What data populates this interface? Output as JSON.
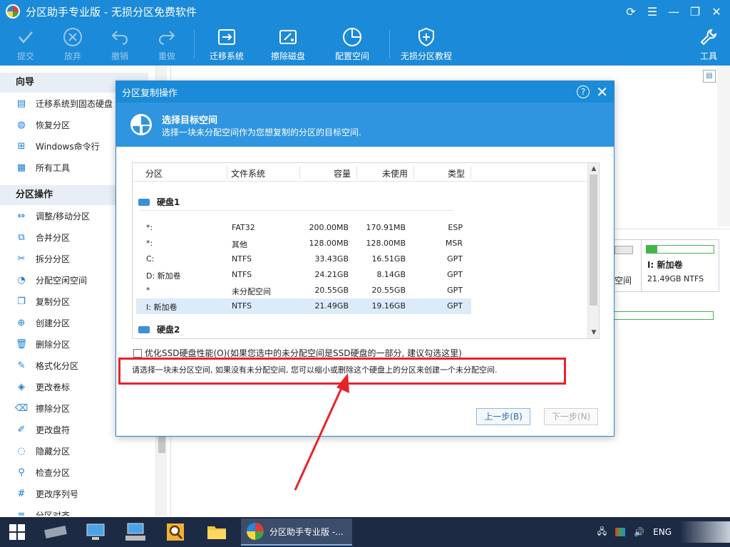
{
  "window": {
    "title": "分区助手专业版 - 无损分区免费软件"
  },
  "toolbar": {
    "submit": "提交",
    "discard": "放弃",
    "undo": "撤销",
    "redo": "重做",
    "migrate": "迁移系统",
    "wipe": "擦除磁盘",
    "alloc": "配置空间",
    "tutorial": "无损分区教程",
    "tools": "工具"
  },
  "sidebar": {
    "guide_title": "向导",
    "guide_items": [
      "迁移系统到固态硬盘",
      "恢复分区",
      "Windows命令行",
      "所有工具"
    ],
    "ops_title": "分区操作",
    "ops_items": [
      "调整/移动分区",
      "合并分区",
      "拆分分区",
      "分配空闲空间",
      "复制分区",
      "创建分区",
      "删除分区",
      "格式化分区",
      "更改卷标",
      "擦除分区",
      "更改盘符",
      "隐藏分区",
      "检查分区",
      "更改序列号",
      "分区对齐"
    ]
  },
  "background": {
    "card_label": "I: 新加卷",
    "card_detail": "21.49GB NTFS",
    "card_partial": "空间"
  },
  "dialog": {
    "title": "分区复制操作",
    "heading": "选择目标空间",
    "subheading": "选择一块未分配空间作为您想复制的分区的目标空间.",
    "columns": [
      "分区",
      "文件系统",
      "容量",
      "未使用",
      "类型"
    ],
    "disk1": "硬盘1",
    "disk2": "硬盘2",
    "rows": [
      {
        "part": "*:",
        "fs": "FAT32",
        "size": "200.00MB",
        "free": "170.91MB",
        "type": "ESP"
      },
      {
        "part": "*:",
        "fs": "其他",
        "size": "128.00MB",
        "free": "128.00MB",
        "type": "MSR"
      },
      {
        "part": "C:",
        "fs": "NTFS",
        "size": "33.43GB",
        "free": "16.51GB",
        "type": "GPT"
      },
      {
        "part": "D: 新加卷",
        "fs": "NTFS",
        "size": "24.21GB",
        "free": "8.14GB",
        "type": "GPT"
      },
      {
        "part": "*",
        "fs": "未分配空间",
        "size": "20.55GB",
        "free": "20.55GB",
        "type": "GPT"
      },
      {
        "part": "I: 新加卷",
        "fs": "NTFS",
        "size": "21.49GB",
        "free": "19.16GB",
        "type": "GPT"
      }
    ],
    "ssd_option": "优化SSD硬盘性能(O)(如果您选中的未分配空间是SSD硬盘的一部分, 建议勾选这里)",
    "hint": "请选择一块未分区空间, 如果没有未分配空间, 您可以缩小或删除这个硬盘上的分区来创建一个未分配空间.",
    "prev_button": "上一步(B)",
    "next_button": "下一步(N)"
  },
  "taskbar": {
    "app_label": "分区助手专业版 -...",
    "lang": "ENG"
  },
  "colors": {
    "accent": "#1b8ad8",
    "highlight": "#e8232a"
  }
}
